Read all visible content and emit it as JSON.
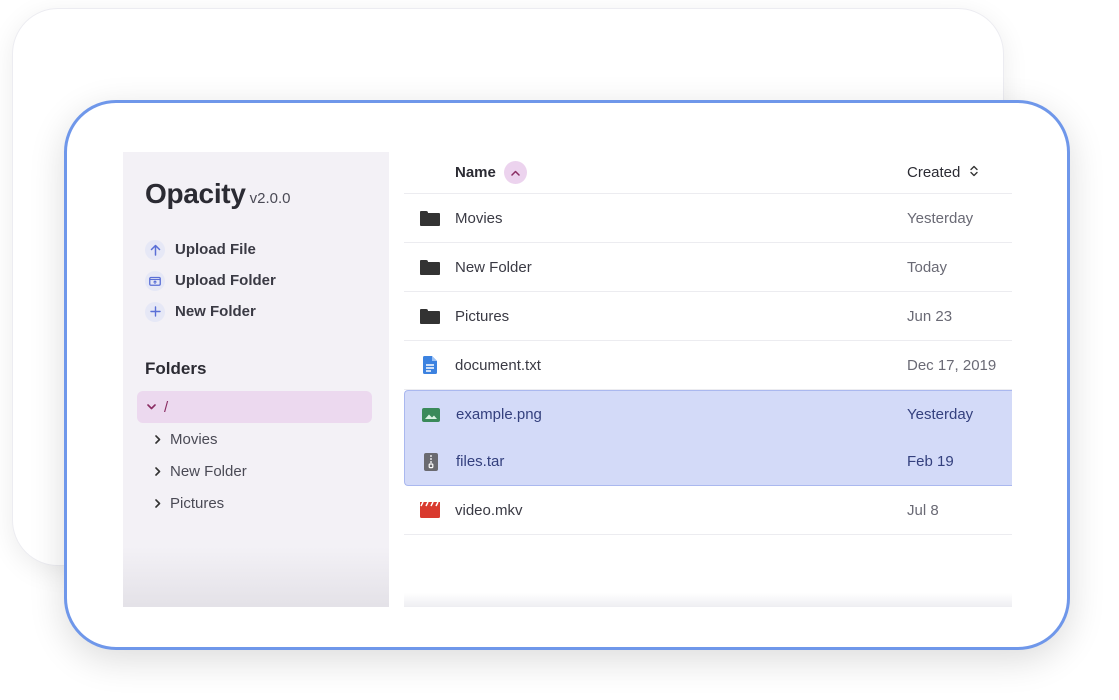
{
  "app": {
    "name": "Opacity",
    "version": "v2.0.0"
  },
  "sidebar": {
    "actions": [
      {
        "label": "Upload File",
        "icon": "arrow-up-icon"
      },
      {
        "label": "Upload Folder",
        "icon": "folder-upload-icon"
      },
      {
        "label": "New Folder",
        "icon": "plus-icon"
      }
    ],
    "folders_title": "Folders",
    "tree": {
      "root": "/",
      "children": [
        "Movies",
        "New Folder",
        "Pictures"
      ]
    }
  },
  "table": {
    "headers": {
      "name": "Name",
      "created": "Created"
    },
    "sort": {
      "column": "name",
      "direction": "ascending"
    },
    "rows": [
      {
        "name": "Movies",
        "created": "Yesterday",
        "type": "folder",
        "selected": false
      },
      {
        "name": "New Folder",
        "created": "Today",
        "type": "folder",
        "selected": false
      },
      {
        "name": "Pictures",
        "created": "Jun 23",
        "type": "folder",
        "selected": false
      },
      {
        "name": "document.txt",
        "created": "Dec 17, 2019",
        "type": "document",
        "selected": false
      },
      {
        "name": "example.png",
        "created": "Yesterday",
        "type": "image",
        "selected": true
      },
      {
        "name": "files.tar",
        "created": "Feb 19",
        "type": "archive",
        "selected": true
      },
      {
        "name": "video.mkv",
        "created": "Jul 8",
        "type": "video",
        "selected": false
      }
    ]
  },
  "colors": {
    "accent_border": "#6f97ea",
    "selected_bg": "#d3daf8",
    "tree_active_bg": "#ecd9ef",
    "tree_active_text": "#8a2d63",
    "document_icon": "#3c82e0",
    "image_icon": "#3a8a5a",
    "video_icon": "#d93a2f",
    "archive_icon": "#6a6a70"
  }
}
